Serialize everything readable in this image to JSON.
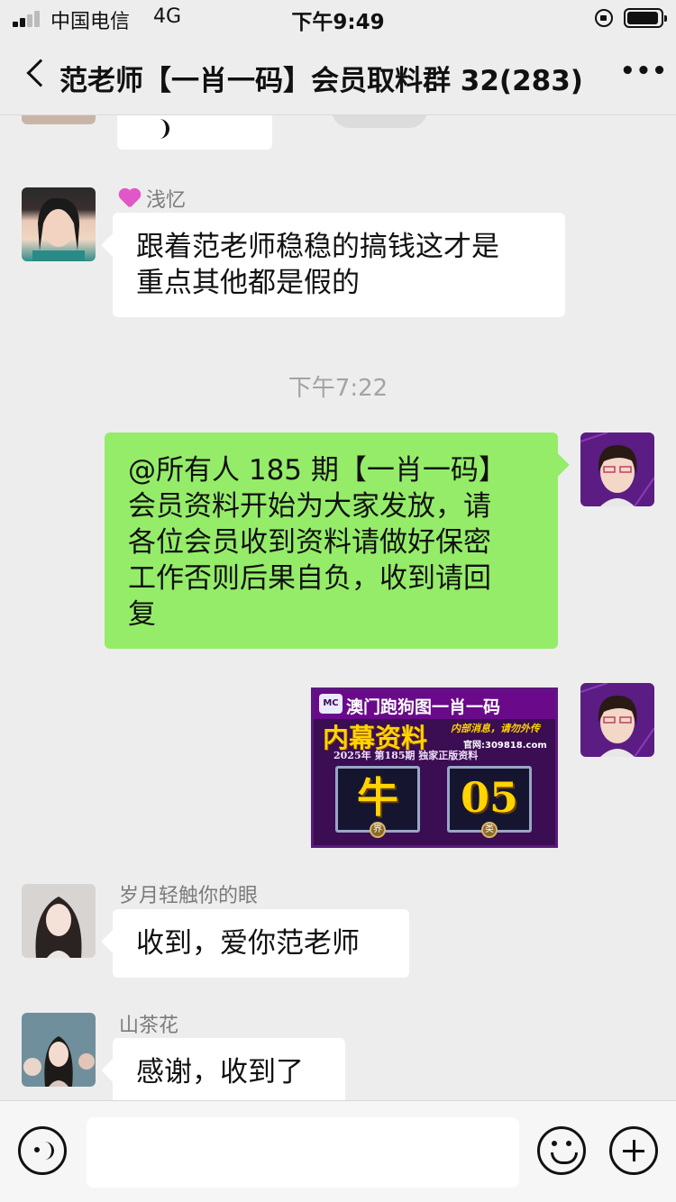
{
  "status_bar": {
    "carrier": "中国电信",
    "network": "4G",
    "time": "下午9:49"
  },
  "nav": {
    "title": "范老师【一肖一码】会员取料群 32(283)",
    "more_icon": "more-dots-icon",
    "back_icon": "chevron-left-icon"
  },
  "messages": {
    "m1": {
      "sender": "浅忆",
      "text_line1": "跟着范老师稳稳的搞钱这才是",
      "text_line2": "重点其他都是假的"
    },
    "timestamp": "下午7:22",
    "m2": {
      "line1": "@所有人 185 期【一肖一码】",
      "line2": "会员资料开始为大家发放，请",
      "line3": "各位会员收到资料请做好保密",
      "line4": "工作否则后果自负，收到请回",
      "line5": "复"
    },
    "m3_image": {
      "title": "澳门跑狗图一肖一码",
      "headline": "内幕资料",
      "slogan": "内部消息，请勿外传",
      "site": "官网:309818.com",
      "issue": "2025年 第185期 独家正版资料",
      "zodiac": "牛",
      "number": "05",
      "medal_left": "界",
      "medal_right": "类"
    },
    "m4": {
      "sender": "岁月轻触你的眼",
      "text": "收到，爱你范老师"
    },
    "m5": {
      "sender": "山茶花",
      "text": "感谢，收到了"
    }
  },
  "input_bar": {
    "placeholder": ""
  },
  "colors": {
    "background": "#ededed",
    "self_bubble": "#95ec69",
    "other_bubble": "#ffffff"
  }
}
